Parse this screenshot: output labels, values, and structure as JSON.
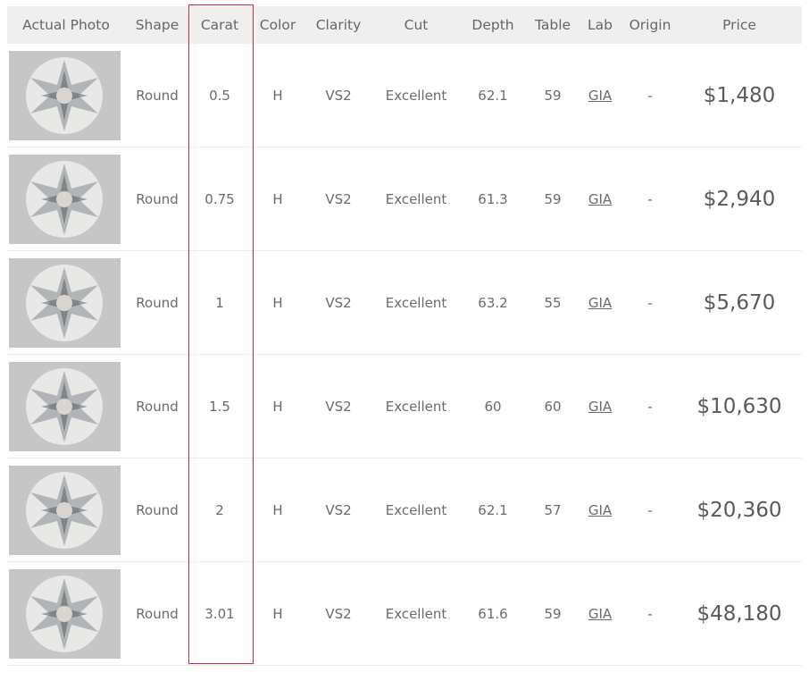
{
  "header": {
    "photo": "Actual Photo",
    "shape": "Shape",
    "carat": "Carat",
    "color": "Color",
    "clarity": "Clarity",
    "cut": "Cut",
    "depth": "Depth",
    "table": "Table",
    "lab": "Lab",
    "origin": "Origin",
    "price": "Price"
  },
  "highlight_color": "#d42a3a",
  "rows": [
    {
      "photo_icon": "diamond-photo",
      "shape": "Round",
      "carat": "0.5",
      "color": "H",
      "clarity": "VS2",
      "cut": "Excellent",
      "depth": "62.1",
      "table": "59",
      "lab": "GIA",
      "origin": "-",
      "price": "$1,480"
    },
    {
      "photo_icon": "diamond-photo",
      "shape": "Round",
      "carat": "0.75",
      "color": "H",
      "clarity": "VS2",
      "cut": "Excellent",
      "depth": "61.3",
      "table": "59",
      "lab": "GIA",
      "origin": "-",
      "price": "$2,940"
    },
    {
      "photo_icon": "diamond-photo",
      "shape": "Round",
      "carat": "1",
      "color": "H",
      "clarity": "VS2",
      "cut": "Excellent",
      "depth": "63.2",
      "table": "55",
      "lab": "GIA",
      "origin": "-",
      "price": "$5,670"
    },
    {
      "photo_icon": "diamond-photo",
      "shape": "Round",
      "carat": "1.5",
      "color": "H",
      "clarity": "VS2",
      "cut": "Excellent",
      "depth": "60",
      "table": "60",
      "lab": "GIA",
      "origin": "-",
      "price": "$10,630"
    },
    {
      "photo_icon": "diamond-photo",
      "shape": "Round",
      "carat": "2",
      "color": "H",
      "clarity": "VS2",
      "cut": "Excellent",
      "depth": "62.1",
      "table": "57",
      "lab": "GIA",
      "origin": "-",
      "price": "$20,360"
    },
    {
      "photo_icon": "diamond-photo",
      "shape": "Round",
      "carat": "3.01",
      "color": "H",
      "clarity": "VS2",
      "cut": "Excellent",
      "depth": "61.6",
      "table": "59",
      "lab": "GIA",
      "origin": "-",
      "price": "$48,180"
    }
  ]
}
